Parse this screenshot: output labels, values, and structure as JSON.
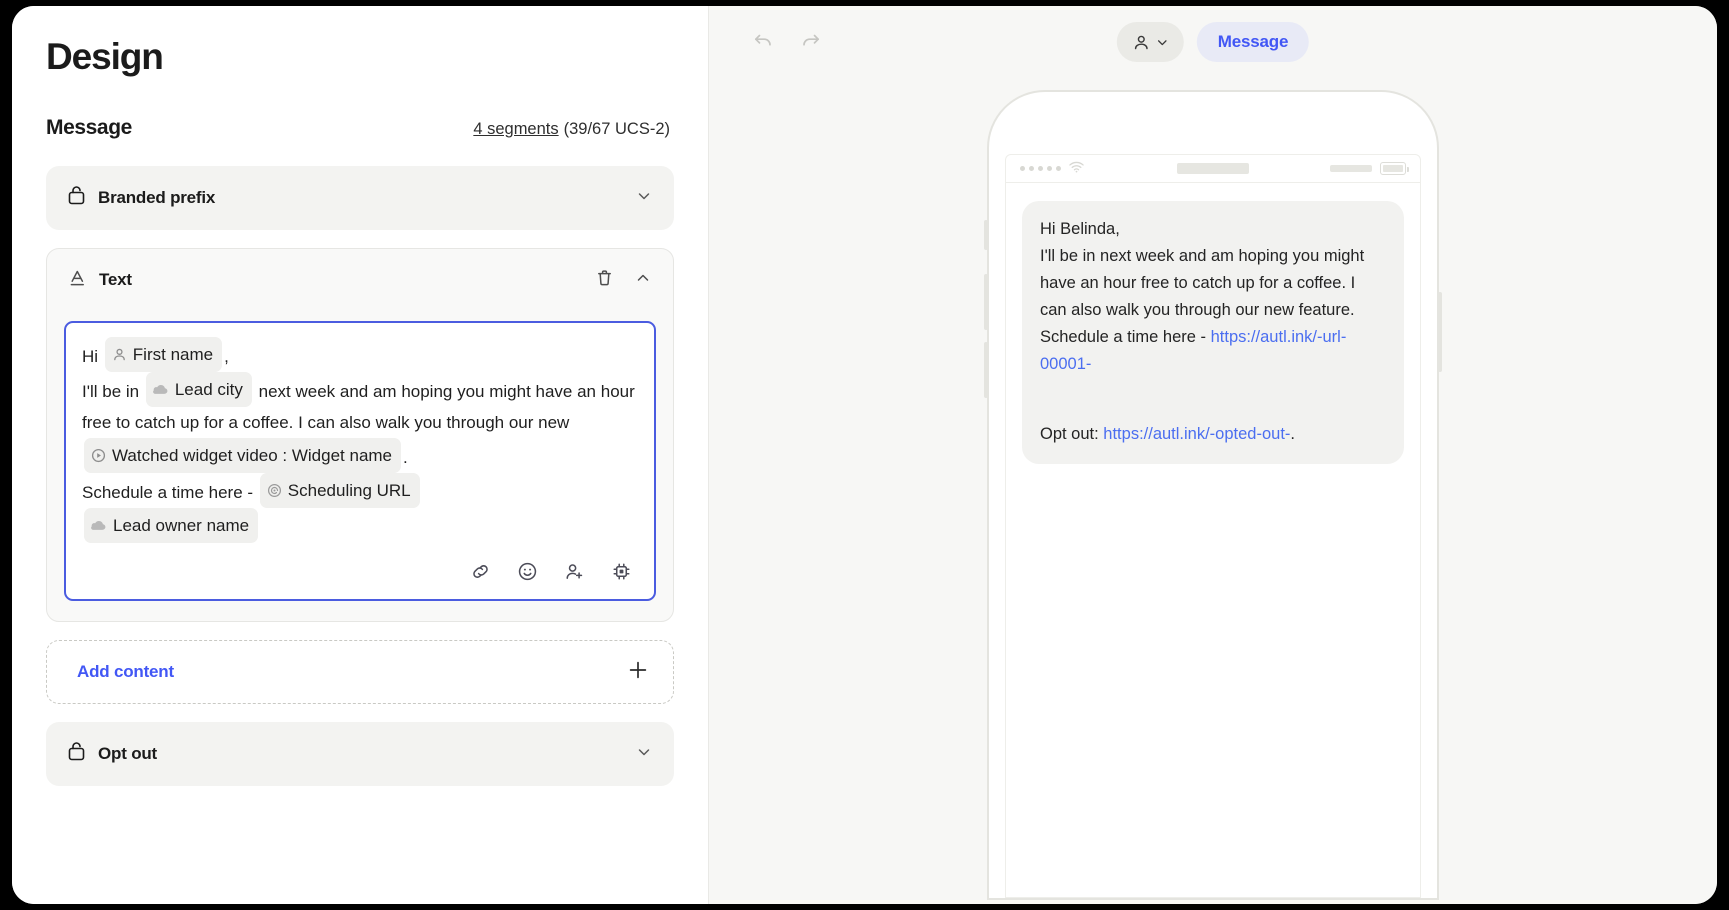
{
  "page": {
    "title": "Design"
  },
  "message_section": {
    "heading": "Message",
    "segments_label": "4 segments",
    "segments_detail": "(39/67 UCS-2)"
  },
  "blocks": {
    "branded_prefix": {
      "label": "Branded prefix",
      "icon": "lock-icon",
      "chevron": "chevron-down-icon"
    },
    "opt_out": {
      "label": "Opt out",
      "icon": "lock-icon",
      "chevron": "chevron-down-icon"
    }
  },
  "text_card": {
    "label": "Text",
    "icon": "text-format-icon",
    "delete_icon": "trash-icon",
    "collapse_icon": "chevron-up-icon",
    "editor": {
      "line1": {
        "prefix": "Hi",
        "chip": {
          "label": "First name",
          "icon": "person-icon"
        },
        "suffix": ","
      },
      "line2": {
        "prefix": "I'll be in",
        "chip": {
          "label": "Lead city",
          "icon": "cloud-icon"
        },
        "suffix": "next week and am hoping you might have an hour free to catch up for a coffee. I can also walk you through our new"
      },
      "line3": {
        "chip": {
          "label": "Watched widget video : Widget name",
          "icon": "play-circle-icon"
        },
        "suffix": "."
      },
      "line4": {
        "prefix": "Schedule a time here -",
        "chip": {
          "label": "Scheduling URL",
          "icon": "spiral-target-icon"
        }
      },
      "line5": {
        "chip": {
          "label": "Lead owner name",
          "icon": "cloud-icon"
        }
      }
    },
    "toolbar": [
      {
        "name": "link-icon",
        "title": "Insert link"
      },
      {
        "name": "emoji-icon",
        "title": "Insert emoji"
      },
      {
        "name": "person-add-icon",
        "title": "Insert merge field"
      },
      {
        "name": "chip-ai-icon",
        "title": "AI assist"
      }
    ]
  },
  "add_content": {
    "label": "Add content",
    "icon": "plus-icon"
  },
  "preview_toolbar": {
    "undo_icon": "undo-icon",
    "redo_icon": "redo-icon",
    "persona": {
      "icon": "person-icon",
      "chevron": "chevron-down-icon"
    },
    "tab_label": "Message"
  },
  "phone_preview": {
    "status_bar": {
      "signal_icon": "signal-dots-icon",
      "wifi_icon": "wifi-icon",
      "battery_icon": "battery-icon"
    },
    "message": {
      "greeting": "Hi Belinda,",
      "body": "I'll be in next week and am hoping you might have an hour free to catch up for a coffee. I can also walk you through our new feature. Schedule a time here -",
      "url": "https://autl.ink/-url-00001-",
      "optout_label": "Opt out:",
      "optout_url": "https://autl.ink/-opted-out-",
      "optout_period": "."
    }
  },
  "colors": {
    "accent": "#4257f5",
    "link": "#4b6ef0",
    "editor_border": "#4b5ce0",
    "panel_bg": "#f7f7f5",
    "block_bg": "#f3f3f1",
    "bubble_bg": "#f2f2f0"
  }
}
